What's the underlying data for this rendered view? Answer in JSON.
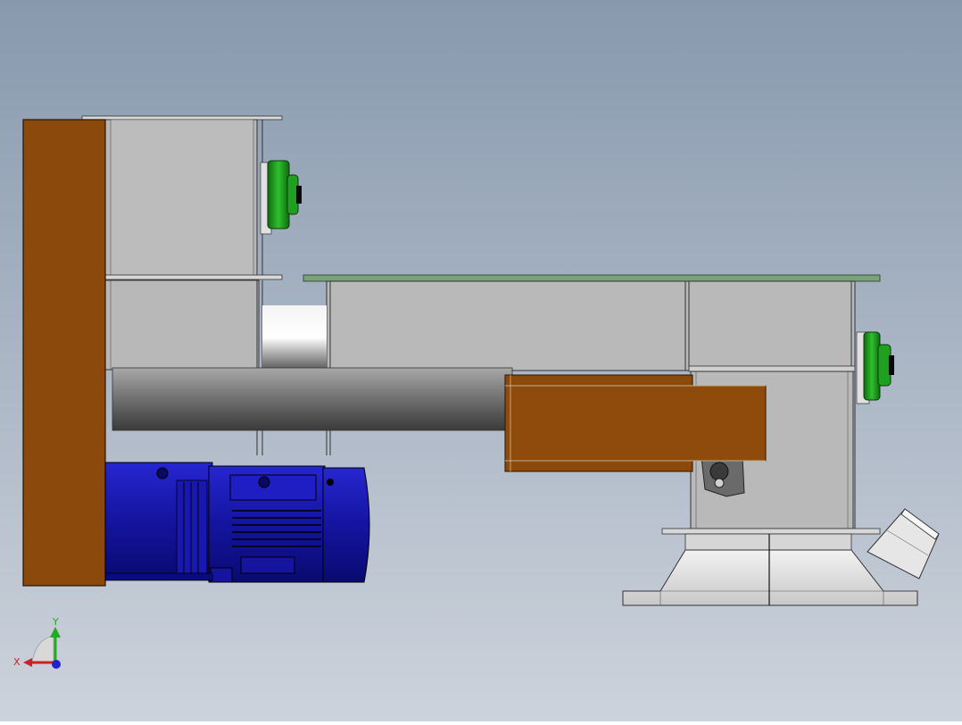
{
  "triad": {
    "y_label": "Y",
    "x_label": "X"
  },
  "colors": {
    "background_top": "#8a9bb0",
    "background_bottom": "#c9cfd8",
    "plate_brown": "#8b4a0c",
    "housing_grey": "#b9b9b9",
    "tube_dark": "#555555",
    "motor_blue": "#1a1ab4",
    "bearing_green": "#1f9a1f",
    "axis_x": "#cc2222",
    "axis_y": "#22aa22",
    "axis_z": "#2222cc"
  }
}
